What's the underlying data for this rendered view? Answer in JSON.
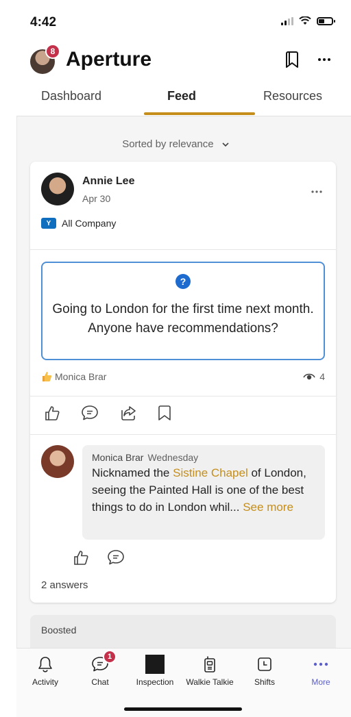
{
  "status": {
    "time": "4:42"
  },
  "header": {
    "app_title": "Aperture",
    "avatar_badge": "8"
  },
  "tabs": [
    {
      "label": "Dashboard",
      "active": false
    },
    {
      "label": "Feed",
      "active": true
    },
    {
      "label": "Resources",
      "active": false
    }
  ],
  "sort": {
    "label": "Sorted by relevance"
  },
  "post": {
    "author": "Annie Lee",
    "date": "Apr 30",
    "community": "All Company",
    "question": "Going to London for the first time next month. Anyone have recommendations?",
    "reacted_by": "Monica Brar",
    "view_count": "4",
    "reply": {
      "author": "Monica Brar",
      "when": "Wednesday",
      "text_before": "Nicknamed the ",
      "link_text": "Sistine Chapel",
      "text_after": " of London, seeing the Painted Hall is one of the best things to do in London whil...",
      "see_more": "See more"
    },
    "answers": "2 answers"
  },
  "boosted": {
    "label": "Boosted"
  },
  "bottom_nav": [
    {
      "label": "Activity",
      "icon": "bell-icon"
    },
    {
      "label": "Chat",
      "icon": "chat-icon",
      "badge": "1"
    },
    {
      "label": "Inspection",
      "icon": "inspection-icon"
    },
    {
      "label": "Walkie Talkie",
      "icon": "walkie-talkie-icon"
    },
    {
      "label": "Shifts",
      "icon": "shifts-icon"
    },
    {
      "label": "More",
      "icon": "more-icon"
    }
  ],
  "colors": {
    "accent": "#c58e1b",
    "badge": "#c4314b",
    "nav_more": "#5b5fc7",
    "question_border": "#4f8fd6"
  }
}
